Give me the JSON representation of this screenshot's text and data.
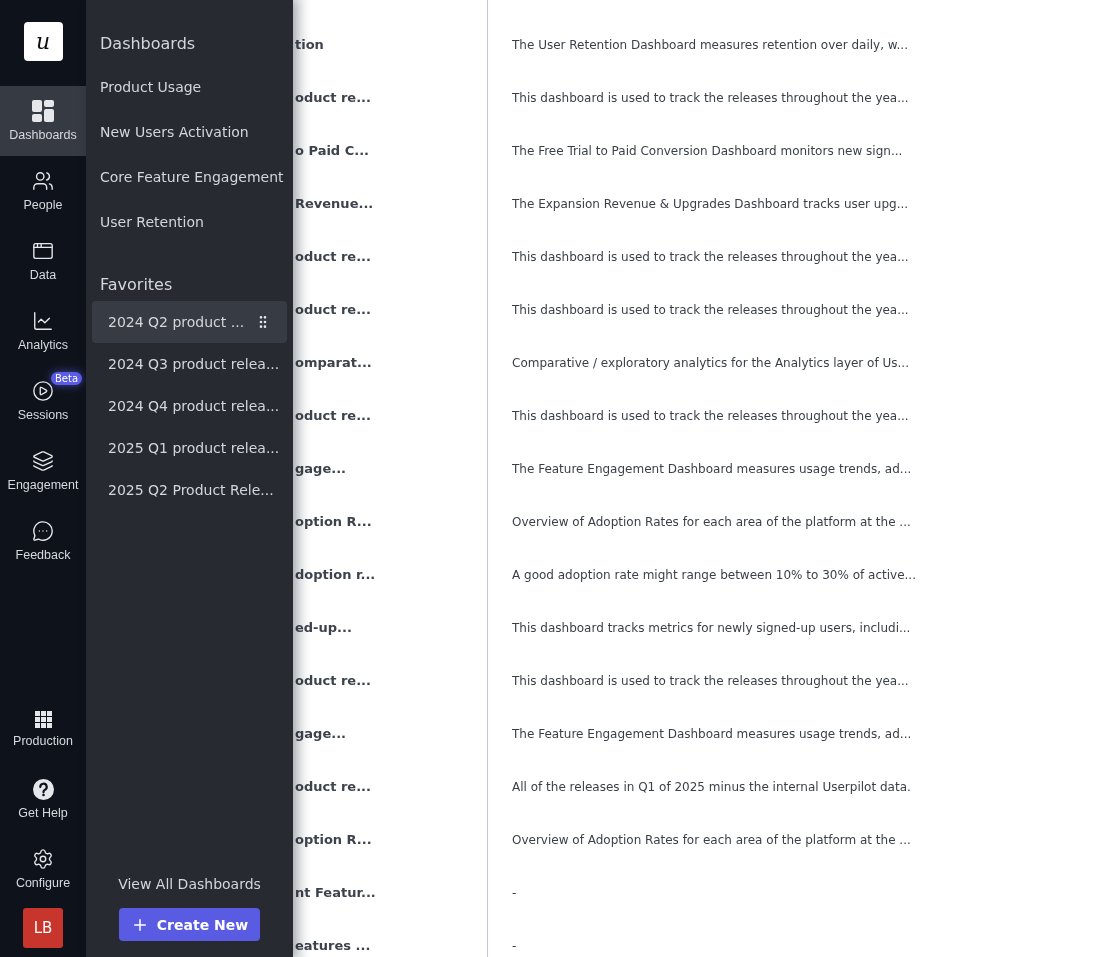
{
  "nav_rail": {
    "logo": "u",
    "items": [
      {
        "label": "Dashboards",
        "selected": true
      },
      {
        "label": "People",
        "selected": false
      },
      {
        "label": "Data",
        "selected": false
      },
      {
        "label": "Analytics",
        "selected": false
      },
      {
        "label": "Sessions",
        "selected": false,
        "badge": "Beta"
      },
      {
        "label": "Engagement",
        "selected": false
      },
      {
        "label": "Feedback",
        "selected": false
      }
    ],
    "bottom_items": [
      {
        "label": "Production",
        "selected": false
      },
      {
        "label": "Get Help",
        "selected": false
      },
      {
        "label": "Configure",
        "selected": false
      }
    ],
    "avatar": "LB"
  },
  "dashboards_panel": {
    "title": "Dashboards",
    "items": [
      "Product Usage",
      "New Users Activation",
      "Core Feature Engagement",
      "User Retention"
    ],
    "favorites_title": "Favorites",
    "favorites": [
      {
        "label": "2024 Q2 product ...",
        "hovered": true
      },
      {
        "label": "2024 Q3 product relea...",
        "hovered": false
      },
      {
        "label": "2024 Q4 product relea...",
        "hovered": false
      },
      {
        "label": "2025 Q1 product relea...",
        "hovered": false
      },
      {
        "label": "2025 Q2 Product Rele...",
        "hovered": false
      }
    ],
    "view_all": "View All Dashboards",
    "create_button": "Create New"
  },
  "table": {
    "rows": [
      {
        "name": "tion",
        "description": "The User Retention Dashboard measures retention over daily, w..."
      },
      {
        "name": "oduct re...",
        "description": "This dashboard is used to track the releases throughout the yea..."
      },
      {
        "name": "o Paid C...",
        "description": "The Free Trial to Paid Conversion Dashboard monitors new sign..."
      },
      {
        "name": "Revenue...",
        "description": "The Expansion Revenue & Upgrades Dashboard tracks user upg..."
      },
      {
        "name": "oduct re...",
        "description": "This dashboard is used to track the releases throughout the yea..."
      },
      {
        "name": "oduct re...",
        "description": "This dashboard is used to track the releases throughout the yea..."
      },
      {
        "name": "omparat...",
        "description": "Comparative / exploratory analytics for the Analytics layer of Us..."
      },
      {
        "name": "oduct re...",
        "description": "This dashboard is used to track the releases throughout the yea..."
      },
      {
        "name": "gage...",
        "description": "The Feature Engagement Dashboard measures usage trends, ad..."
      },
      {
        "name": "option R...",
        "description": "Overview of Adoption Rates for each area of the platform at the ..."
      },
      {
        "name": "doption r...",
        "description": "A good adoption rate might range between 10% to 30% of active..."
      },
      {
        "name": "ed-up...",
        "description": "This dashboard tracks metrics for newly signed-up users, includi..."
      },
      {
        "name": "oduct re...",
        "description": "This dashboard is used to track the releases throughout the yea..."
      },
      {
        "name": "gage...",
        "description": "The Feature Engagement Dashboard measures usage trends, ad..."
      },
      {
        "name": "oduct re...",
        "description": "All of the releases in Q1 of 2025 minus the internal Userpilot data."
      },
      {
        "name": "option R...",
        "description": "Overview of Adoption Rates for each area of the platform at the ..."
      },
      {
        "name": "nt Featur...",
        "description": "-"
      },
      {
        "name": "eatures ...",
        "description": "-"
      }
    ]
  }
}
